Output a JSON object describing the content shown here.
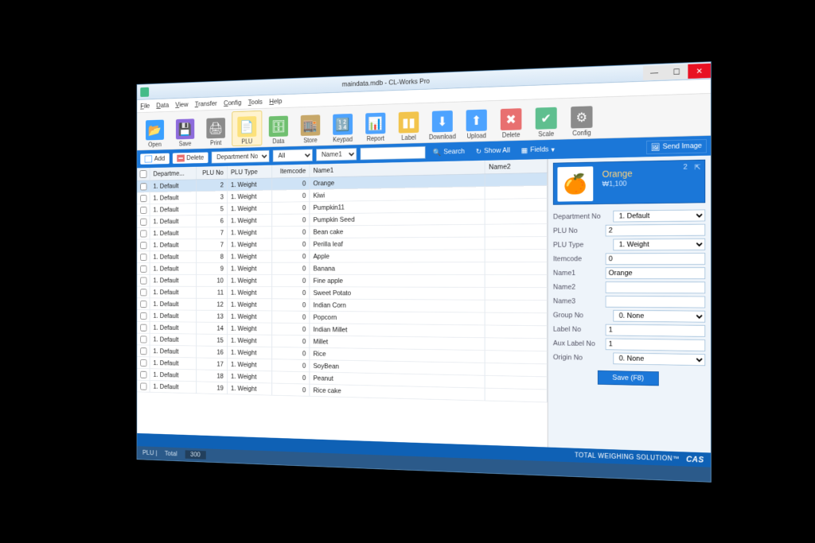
{
  "window": {
    "title": "maindata.mdb - CL-Works Pro"
  },
  "menu": [
    "File",
    "Data",
    "View",
    "Transfer",
    "Config",
    "Tools",
    "Help"
  ],
  "toolbar": [
    {
      "label": "Open",
      "icon": "📂",
      "bg": "#3aa0ff"
    },
    {
      "label": "Save",
      "icon": "💾",
      "bg": "#8d6bdc"
    },
    {
      "label": "Print",
      "icon": "🖨",
      "bg": "#8b8b8b"
    },
    {
      "label": "PLU",
      "icon": "📄",
      "bg": "#fce17a",
      "active": true
    },
    {
      "label": "Data",
      "icon": "🗄",
      "bg": "#6fbf6f"
    },
    {
      "label": "Store",
      "icon": "🏬",
      "bg": "#c7a86a"
    },
    {
      "label": "Keypad",
      "icon": "🔢",
      "bg": "#4da3ff"
    },
    {
      "label": "Report",
      "icon": "📊",
      "bg": "#4da3ff"
    },
    {
      "label": "Label",
      "icon": "▮▮",
      "bg": "#f2c44c"
    },
    {
      "label": "Download",
      "icon": "⬇",
      "bg": "#4da3ff"
    },
    {
      "label": "Upload",
      "icon": "⬆",
      "bg": "#4da3ff"
    },
    {
      "label": "Delete",
      "icon": "✖",
      "bg": "#e87070"
    },
    {
      "label": "Scale",
      "icon": "✔",
      "bg": "#5fbf8f"
    },
    {
      "label": "Config",
      "icon": "⚙",
      "bg": "#8b8b8b"
    }
  ],
  "filter": {
    "add": "Add",
    "delete": "Delete",
    "deptLabel": "Department No",
    "deptVal": "All",
    "nameField": "Name1",
    "search": "Search",
    "showAll": "Show All",
    "fields": "Fields",
    "sendImage": "Send Image"
  },
  "columns": {
    "dept": "Departme...",
    "plu": "PLU No",
    "type": "PLU Type",
    "item": "Itemcode",
    "name1": "Name1",
    "name2": "Name2"
  },
  "rows": [
    {
      "dept": "1. Default",
      "plu": 2,
      "type": "1. Weight",
      "item": 0,
      "name1": "Orange",
      "sel": true
    },
    {
      "dept": "1. Default",
      "plu": 3,
      "type": "1. Weight",
      "item": 0,
      "name1": "Kiwi"
    },
    {
      "dept": "1. Default",
      "plu": 5,
      "type": "1. Weight",
      "item": 0,
      "name1": "Pumpkin11"
    },
    {
      "dept": "1. Default",
      "plu": 6,
      "type": "1. Weight",
      "item": 0,
      "name1": "Pumpkin Seed"
    },
    {
      "dept": "1. Default",
      "plu": 7,
      "type": "1. Weight",
      "item": 0,
      "name1": "Bean cake"
    },
    {
      "dept": "1. Default",
      "plu": 7,
      "type": "1. Weight",
      "item": 0,
      "name1": "Perilla leaf"
    },
    {
      "dept": "1. Default",
      "plu": 8,
      "type": "1. Weight",
      "item": 0,
      "name1": "Apple"
    },
    {
      "dept": "1. Default",
      "plu": 9,
      "type": "1. Weight",
      "item": 0,
      "name1": "Banana"
    },
    {
      "dept": "1. Default",
      "plu": 10,
      "type": "1. Weight",
      "item": 0,
      "name1": "Fine apple"
    },
    {
      "dept": "1. Default",
      "plu": 11,
      "type": "1. Weight",
      "item": 0,
      "name1": "Sweet Potato"
    },
    {
      "dept": "1. Default",
      "plu": 12,
      "type": "1. Weight",
      "item": 0,
      "name1": "Indian Corn"
    },
    {
      "dept": "1. Default",
      "plu": 13,
      "type": "1. Weight",
      "item": 0,
      "name1": "Popcorn"
    },
    {
      "dept": "1. Default",
      "plu": 14,
      "type": "1. Weight",
      "item": 0,
      "name1": "Indian Millet"
    },
    {
      "dept": "1. Default",
      "plu": 15,
      "type": "1. Weight",
      "item": 0,
      "name1": "Millet"
    },
    {
      "dept": "1. Default",
      "plu": 16,
      "type": "1. Weight",
      "item": 0,
      "name1": "Rice"
    },
    {
      "dept": "1. Default",
      "plu": 17,
      "type": "1. Weight",
      "item": 0,
      "name1": "SoyBean"
    },
    {
      "dept": "1. Default",
      "plu": 18,
      "type": "1. Weight",
      "item": 0,
      "name1": "Peanut"
    },
    {
      "dept": "1. Default",
      "plu": 19,
      "type": "1. Weight",
      "item": 0,
      "name1": "Rice cake"
    }
  ],
  "detail": {
    "cardNum": "2",
    "cardName": "Orange",
    "cardPrice": "₩1,100",
    "fields": [
      {
        "label": "Department No",
        "value": "1. Default",
        "type": "select"
      },
      {
        "label": "PLU No",
        "value": "2",
        "type": "text"
      },
      {
        "label": "PLU Type",
        "value": "1. Weight",
        "type": "select"
      },
      {
        "label": "Itemcode",
        "value": "0",
        "type": "text"
      },
      {
        "label": "Name1",
        "value": "Orange",
        "type": "text"
      },
      {
        "label": "Name2",
        "value": "",
        "type": "text"
      },
      {
        "label": "Name3",
        "value": "",
        "type": "text"
      },
      {
        "label": "Group No",
        "value": "0. None",
        "type": "select"
      },
      {
        "label": "Label No",
        "value": "1",
        "type": "text"
      },
      {
        "label": "Aux Label No",
        "value": "1",
        "type": "text"
      },
      {
        "label": "Origin No",
        "value": "0. None",
        "type": "select"
      }
    ],
    "saveLabel": "Save (F8)"
  },
  "footer": {
    "tagline": "TOTAL WEIGHING SOLUTION™",
    "brand": "CAS",
    "statusL": "PLU |",
    "statusM": "Total",
    "count": "300"
  }
}
